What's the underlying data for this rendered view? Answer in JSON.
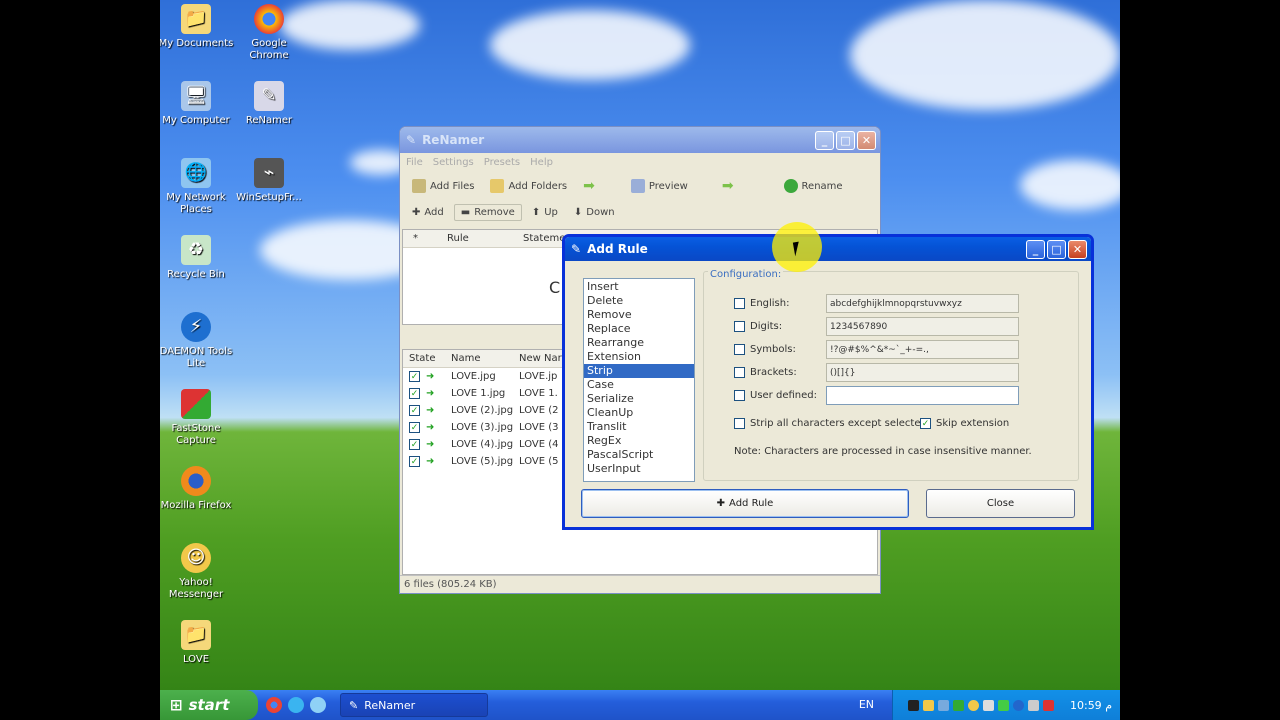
{
  "desktop": {
    "icons": [
      {
        "label": "My Documents"
      },
      {
        "label": "Google Chrome"
      },
      {
        "label": "My Computer"
      },
      {
        "label": "ReNamer"
      },
      {
        "label": "My Network Places"
      },
      {
        "label": "WinSetupFr..."
      },
      {
        "label": "Recycle Bin"
      },
      {
        "label": "DAEMON Tools Lite"
      },
      {
        "label": "FastStone Capture"
      },
      {
        "label": "Mozilla Firefox"
      },
      {
        "label": "Yahoo! Messenger"
      },
      {
        "label": "LOVE"
      }
    ]
  },
  "renamer": {
    "title": "ReNamer",
    "menu": [
      "File",
      "Settings",
      "Presets",
      "Help"
    ],
    "toolbar": {
      "add_files": "Add Files",
      "add_folders": "Add Folders",
      "preview": "Preview",
      "rename": "Rename"
    },
    "rule_bar": {
      "add": "Add",
      "remove": "Remove",
      "up": "Up",
      "down": "Down"
    },
    "rules_headers": {
      "col1": "*",
      "col2": "Rule",
      "col3": "Stateme"
    },
    "rules_partial_text": "C",
    "files_headers": {
      "state": "State",
      "name": "Name",
      "new_name": "New Nar"
    },
    "files": [
      {
        "name": "LOVE.jpg",
        "new_name": "LOVE.jp"
      },
      {
        "name": "LOVE 1.jpg",
        "new_name": "LOVE 1."
      },
      {
        "name": "LOVE (2).jpg",
        "new_name": "LOVE (2"
      },
      {
        "name": "LOVE (3).jpg",
        "new_name": "LOVE (3"
      },
      {
        "name": "LOVE (4).jpg",
        "new_name": "LOVE (4"
      },
      {
        "name": "LOVE (5).jpg",
        "new_name": "LOVE (5"
      }
    ],
    "status": "6 files (805.24 KB)"
  },
  "dialog": {
    "title": "Add Rule",
    "rules": [
      "Insert",
      "Delete",
      "Remove",
      "Replace",
      "Rearrange",
      "Extension",
      "Strip",
      "Case",
      "Serialize",
      "CleanUp",
      "Translit",
      "RegEx",
      "PascalScript",
      "UserInput"
    ],
    "selected_rule": "Strip",
    "config_title": "Configuration:",
    "options": [
      {
        "label": "English:",
        "value": "abcdefghijklmnopqrstuvwxyz",
        "checked": false
      },
      {
        "label": "Digits:",
        "value": "1234567890",
        "checked": false
      },
      {
        "label": "Symbols:",
        "value": "!?@#$%^&*~`_+-=.,",
        "checked": false
      },
      {
        "label": "Brackets:",
        "value": "()[]{}",
        "checked": false
      },
      {
        "label": "User defined:",
        "value": "",
        "checked": false
      }
    ],
    "strip_all_except": "Strip all characters except selected",
    "skip_extension": "Skip extension",
    "note": "Note: Characters are processed in case insensitive manner.",
    "add_rule_button": "Add Rule",
    "close_button": "Close"
  },
  "taskbar": {
    "start": "start",
    "task": "ReNamer",
    "language": "EN",
    "clock": "10:59 م"
  }
}
